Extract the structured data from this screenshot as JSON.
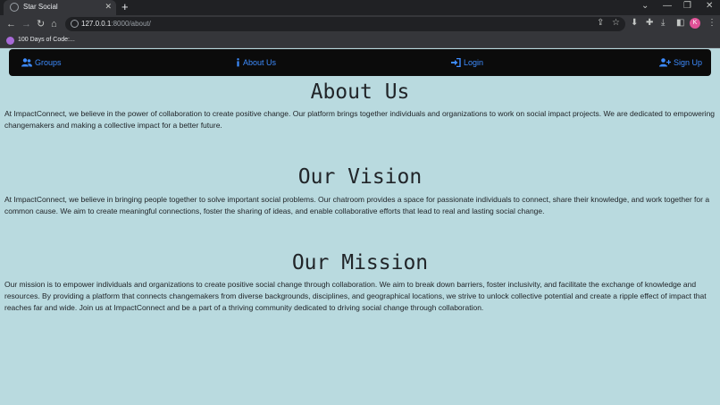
{
  "browser": {
    "tab_title": "Star Social",
    "url_host": "127.0.0.1",
    "url_rest": ":8000/about/",
    "bookmark_label": "100 Days of Code:...",
    "avatar_letter": "K"
  },
  "nav": {
    "groups": "Groups",
    "about": "About Us",
    "login": "Login",
    "signup": "Sign Up"
  },
  "sections": [
    {
      "heading": "About Us",
      "text": "At ImpactConnect, we believe in the power of collaboration to create positive change. Our platform brings together individuals and organizations to work on social impact projects. We are dedicated to empowering changemakers and making a collective impact for a better future."
    },
    {
      "heading": "Our Vision",
      "text": "At ImpactConnect, we believe in bringing people together to solve important social problems. Our chatroom provides a space for passionate individuals to connect, share their knowledge, and work together for a common cause. We aim to create meaningful connections, foster the sharing of ideas, and enable collaborative efforts that lead to real and lasting social change."
    },
    {
      "heading": "Our Mission",
      "text": "Our mission is to empower individuals and organizations to create positive social change through collaboration. We aim to break down barriers, foster inclusivity, and facilitate the exchange of knowledge and resources. By providing a platform that connects changemakers from diverse backgrounds, disciplines, and geographical locations, we strive to unlock collective potential and create a ripple effect of impact that reaches far and wide. Join us at ImpactConnect and be a part of a thriving community dedicated to driving social change through collaboration."
    }
  ],
  "colors": {
    "page_bg": "#b9dadf",
    "navbar_bg": "#0b0b0b",
    "link": "#3d8bfd",
    "text": "#212529"
  }
}
